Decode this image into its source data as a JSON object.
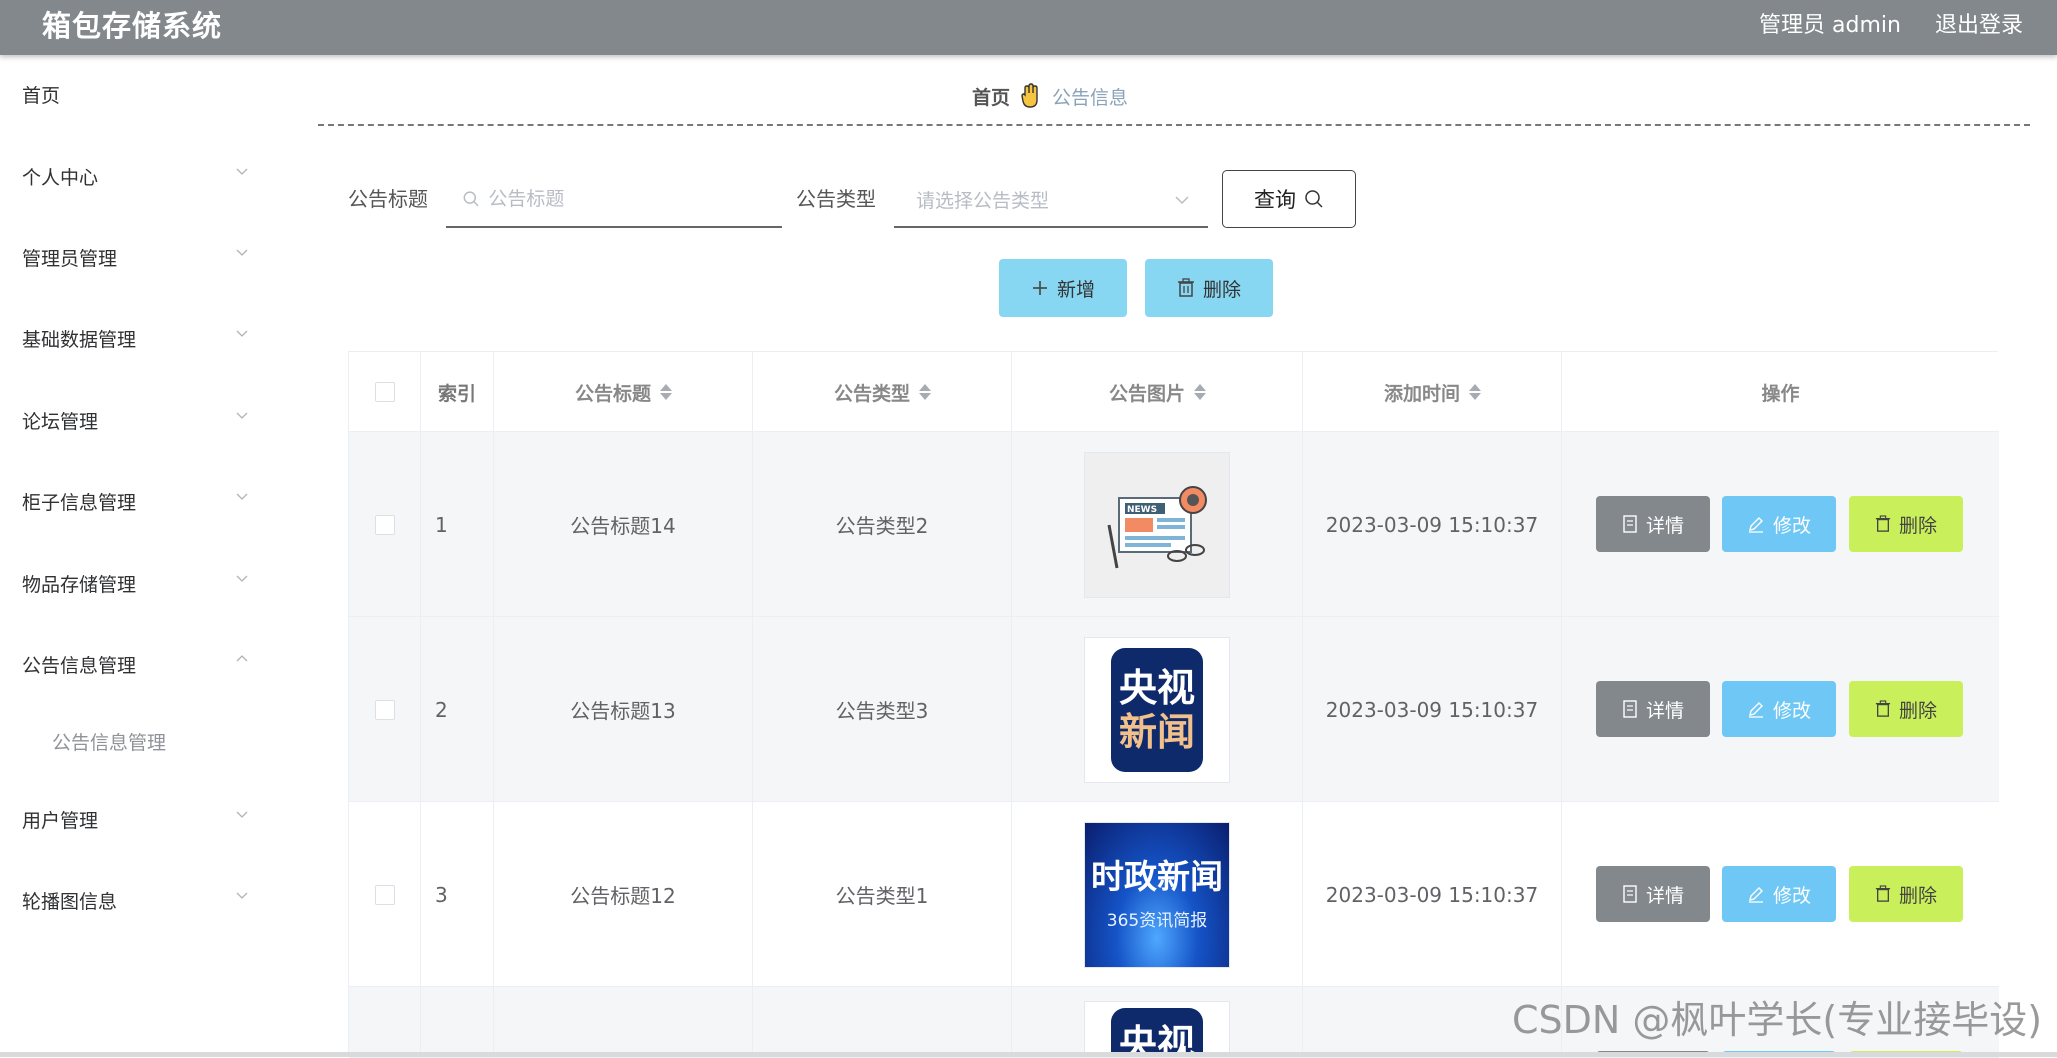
{
  "header": {
    "title": "箱包存储系统",
    "user_label": "管理员 admin",
    "logout_label": "退出登录"
  },
  "sidebar": {
    "items": [
      {
        "label": "首页",
        "expandable": false
      },
      {
        "label": "个人中心",
        "expandable": true
      },
      {
        "label": "管理员管理",
        "expandable": true
      },
      {
        "label": "基础数据管理",
        "expandable": true
      },
      {
        "label": "论坛管理",
        "expandable": true
      },
      {
        "label": "柜子信息管理",
        "expandable": true
      },
      {
        "label": "物品存储管理",
        "expandable": true
      },
      {
        "label": "公告信息管理",
        "expandable": true,
        "expanded": true
      },
      {
        "label": "用户管理",
        "expandable": true
      },
      {
        "label": "轮播图信息",
        "expandable": true
      }
    ],
    "sub_item": "公告信息管理"
  },
  "breadcrumb": {
    "home": "首页",
    "current": "公告信息"
  },
  "search": {
    "title_label": "公告标题",
    "title_placeholder": "公告标题",
    "type_label": "公告类型",
    "type_placeholder": "请选择公告类型",
    "query_label": "查询"
  },
  "actions": {
    "add_label": "新增",
    "delete_label": "删除"
  },
  "table": {
    "columns": [
      "",
      "索引",
      "公告标题",
      "公告类型",
      "公告图片",
      "添加时间",
      "操作"
    ],
    "rows": [
      {
        "index": "1",
        "title": "公告标题14",
        "type": "公告类型2",
        "image": "news-illustration",
        "time": "2023-03-09 15:10:37"
      },
      {
        "index": "2",
        "title": "公告标题13",
        "type": "公告类型3",
        "image": "cctv-news-logo",
        "image_text": [
          "央视",
          "新闻"
        ],
        "time": "2023-03-09 15:10:37"
      },
      {
        "index": "3",
        "title": "公告标题12",
        "type": "公告类型1",
        "image": "political-news-banner",
        "image_text": [
          "时政新闻",
          "365资讯简报"
        ],
        "time": "2023-03-09 15:10:37"
      }
    ],
    "partial_row_image_text": "央视",
    "op_detail": "详情",
    "op_edit": "修改",
    "op_delete": "删除"
  },
  "colors": {
    "header_bg": "#82888c",
    "action_blue": "#87d6f2",
    "edit_blue": "#6ec7f5",
    "delete_lime": "#c9f05a",
    "detail_gray": "#82888c"
  },
  "icons": {
    "breadcrumb": "hand-icon",
    "search": "search-icon",
    "dropdown": "chevron-down-icon",
    "add": "plus-icon",
    "delete": "trash-icon",
    "detail": "document-icon",
    "edit": "pencil-icon"
  },
  "watermark": "CSDN @枫叶学长(专业接毕设)"
}
